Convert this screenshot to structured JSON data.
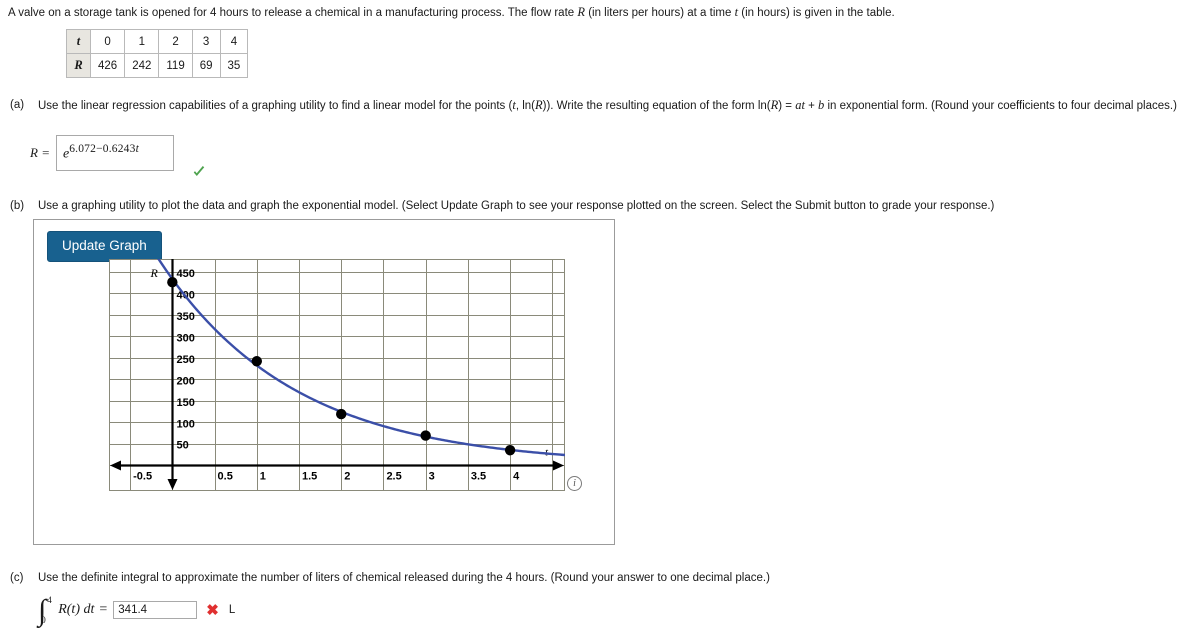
{
  "problem": {
    "statement_parts": [
      "A valve on a storage tank is opened for 4 hours to release a chemical in a manufacturing process. The flow rate ",
      "R",
      " (in liters per hours) at a time ",
      "t",
      " (in hours) is given in the table."
    ],
    "statement_full": "A valve on a storage tank is opened for 4 hours to release a chemical in a manufacturing process. The flow rate R (in liters per hours) at a time t (in hours) is given in the table."
  },
  "table": {
    "row_labels": [
      "t",
      "R"
    ],
    "t_values": [
      "0",
      "1",
      "2",
      "3",
      "4"
    ],
    "r_values": [
      "426",
      "242",
      "119",
      "69",
      "35"
    ]
  },
  "parts": {
    "a": {
      "label": "(a)",
      "text_1": "Use the linear regression capabilities of a graphing utility to find a linear model for the points (",
      "text_t": "t",
      "text_2": ", ln(",
      "text_R": "R",
      "text_3": ")). Write the resulting equation of the form ln(",
      "text_4": ") = ",
      "text_at": "at",
      "text_5": " + ",
      "text_b": "b",
      "text_6": " in exponential form. (Round your coefficients to four decimal places.)",
      "full_text": "Use the linear regression capabilities of a graphing utility to find a linear model for the points (t, ln(R)). Write the resulting equation of the form ln(R) = at + b in exponential form. (Round your coefficients to four decimal places.)",
      "answer_label": "R =",
      "answer_base": "e",
      "answer_exponent_constant": "6.072",
      "answer_exponent_operator": "−",
      "answer_exponent_coefficient": "0.6243",
      "answer_exponent_variable": "t",
      "answer_full": "R = e^(6.072 − 0.6243t)",
      "feedback_icon": "check-icon",
      "feedback_color": "#4fa34f",
      "status": "correct"
    },
    "b": {
      "label": "(b)",
      "full_text": "Use a graphing utility to plot the data and graph the exponential model. (Select Update Graph to see your response plotted on the screen. Select the Submit button to grade your response.)",
      "update_button_label": "Update Graph",
      "update_button_color": "#18618f",
      "info_icon": "info-icon",
      "info_icon_glyph": "i"
    },
    "c": {
      "label": "(c)",
      "full_text": "Use the definite integral to approximate the number of liters of chemical released during the 4 hours. (Round your answer to one decimal place.)",
      "integral_lower": "0",
      "integral_upper": "4",
      "integrand": "R(t) dt",
      "equals": "=",
      "answer_value": "341.4",
      "answer_placeholder": "",
      "unit": "L",
      "feedback_icon": "x-icon",
      "feedback_color": "#e03030",
      "status": "incorrect"
    }
  },
  "chart_data": {
    "type": "scatter",
    "title": "",
    "xlabel": "t",
    "ylabel": "R",
    "xlim": [
      -0.75,
      4.65
    ],
    "ylim": [
      -60,
      480
    ],
    "xticks": [
      "-0.5",
      "0.5",
      "1",
      "1.5",
      "2",
      "2.5",
      "3",
      "3.5",
      "4"
    ],
    "xtick_values": [
      -0.5,
      0.5,
      1,
      1.5,
      2,
      2.5,
      3,
      3.5,
      4
    ],
    "yticks": [
      "50",
      "100",
      "150",
      "200",
      "250",
      "300",
      "350",
      "400",
      "450"
    ],
    "ytick_values": [
      50,
      100,
      150,
      200,
      250,
      300,
      350,
      400,
      450
    ],
    "grid": true,
    "grid_color": "#8a8a7a",
    "legend": "none",
    "series": [
      {
        "name": "data points",
        "type": "scatter",
        "color": "#000000",
        "x": [
          0,
          1,
          2,
          3,
          4
        ],
        "y": [
          426,
          242,
          119,
          69,
          35
        ]
      },
      {
        "name": "exponential model R = e^(6.072 - 0.6243t)",
        "type": "line",
        "color": "#3b4fa8",
        "model": "exponential",
        "a": 6.072,
        "b": -0.6243
      }
    ]
  }
}
